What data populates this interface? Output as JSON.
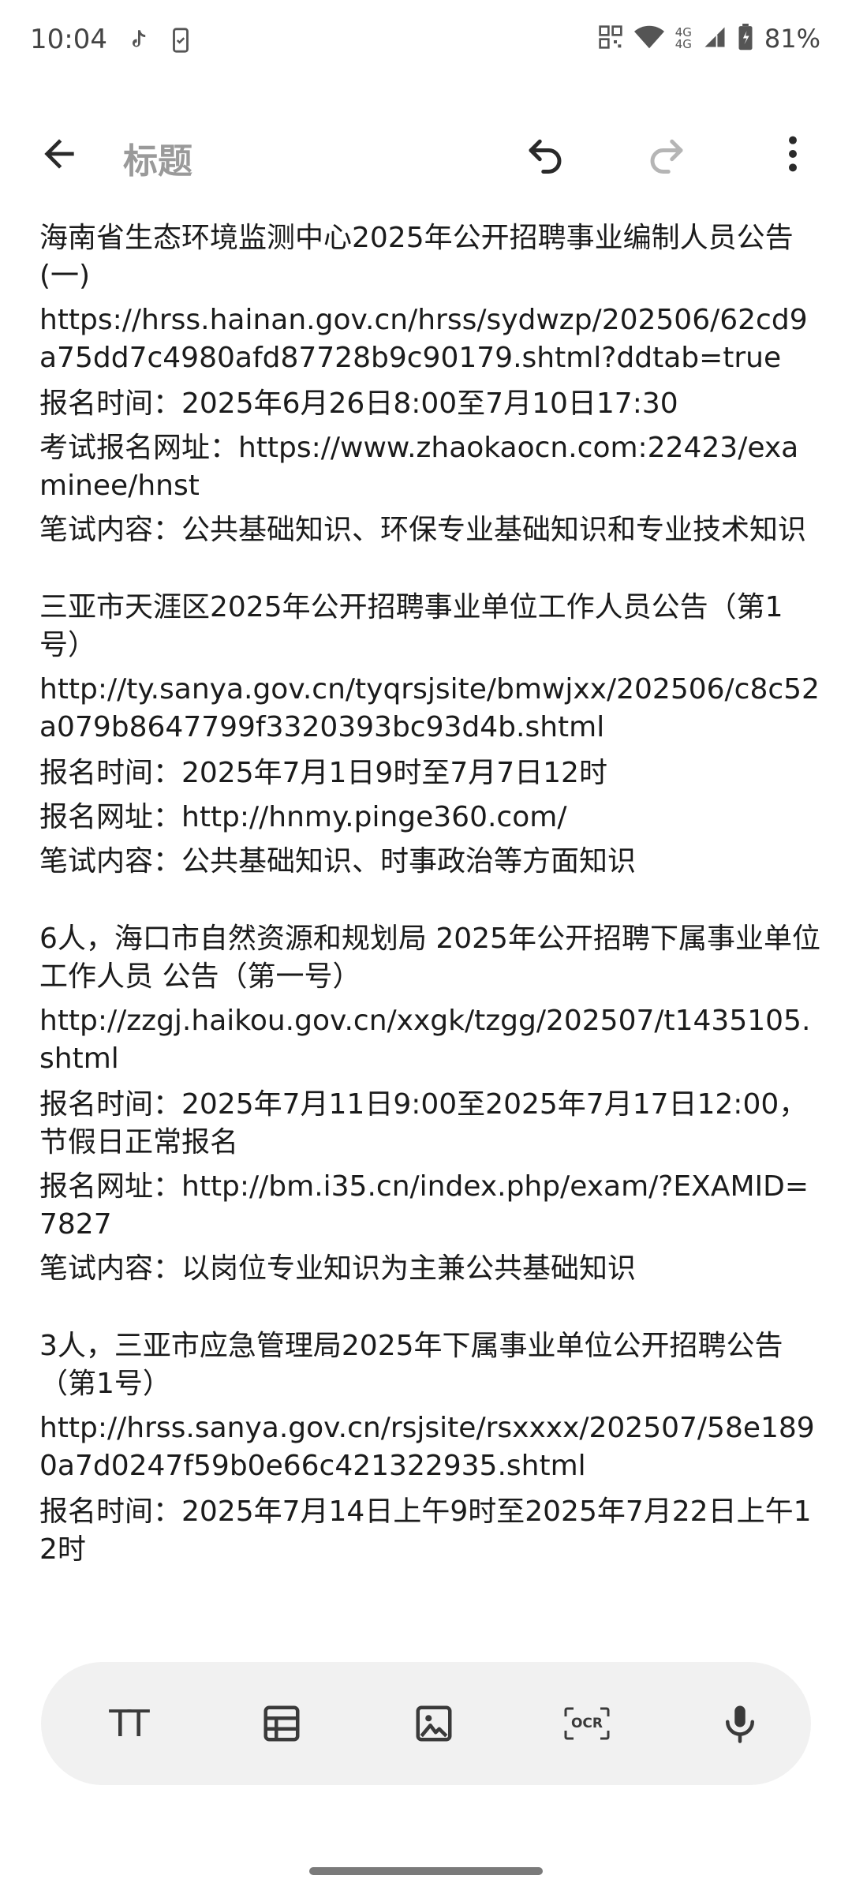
{
  "status_bar": {
    "time": "10:04",
    "network_top": "4G",
    "network_bottom": "4G",
    "battery_text": "81%",
    "battery_level": 0.81
  },
  "app_bar": {
    "title_placeholder": "标题"
  },
  "note": {
    "blocks": [
      {
        "lines": [
          "海南省生态环境监测中心2025年公开招聘事业编制人员公告(一)",
          "https://hrss.hainan.gov.cn/hrss/sydwzp/202506/62cd9a75dd7c4980afd87728b9c90179.shtml?ddtab=true",
          "报名时间：2025年6月26日8:00至7月10日17:30",
          "考试报名网址：https://www.zhaokaocn.com:22423/examinee/hnst",
          "笔试内容：公共基础知识、环保专业基础知识和专业技术知识"
        ]
      },
      {
        "lines": [
          "三亚市天涯区2025年公开招聘事业单位工作人员公告（第1号）",
          "http://ty.sanya.gov.cn/tyqrsjsite/bmwjxx/202506/c8c52a079b8647799f3320393bc93d4b.shtml",
          "报名时间：2025年7月1日9时至7月7日12时",
          "报名网址：http://hnmy.pinge360.com/",
          "笔试内容：公共基础知识、时事政治等方面知识"
        ]
      },
      {
        "lines": [
          "6人，海口市自然资源和规划局 2025年公开招聘下属事业单位工作人员 公告（第一号）",
          "http://zzgj.haikou.gov.cn/xxgk/tzgg/202507/t1435105.shtml",
          "报名时间：2025年7月11日9:00至2025年7月17日12:00，节假日正常报名",
          "报名网址：http://bm.i35.cn/index.php/exam/?EXAMID=7827",
          "笔试内容：以岗位专业知识为主兼公共基础知识"
        ]
      },
      {
        "lines": [
          "3人，三亚市应急管理局2025年下属事业单位公开招聘公告（第1号）",
          "http://hrss.sanya.gov.cn/rsjsite/rsxxxx/202507/58e1890a7d0247f59b0e66c421322935.shtml",
          "报名时间：2025年7月14日上午9时至2025年7月22日上午12时"
        ]
      }
    ]
  },
  "toolbar": {
    "text_format_icon_label": "TT",
    "ocr_icon_label": "OCR"
  },
  "colors": {
    "background": "#ffffff",
    "text": "#1b1b1b",
    "title_placeholder": "#9a9a9a",
    "toolbar_bg": "#f1f1f1",
    "icon": "#3a3a3a",
    "icon_disabled": "#b5b5b5"
  }
}
